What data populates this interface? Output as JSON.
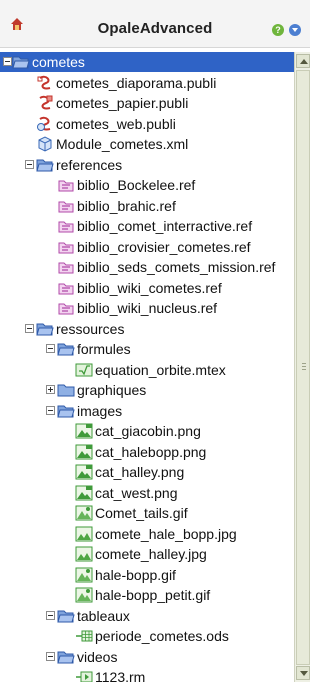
{
  "header": {
    "title": "OpaleAdvanced",
    "app_icon": "opale-app-icon",
    "help_icon": "help-icon",
    "menu_icon": "down-arrow-menu-icon"
  },
  "tree": [
    {
      "label": "cometes",
      "icon": "folder-open-icon",
      "level": 0,
      "toggle": "minus",
      "selected": true
    },
    {
      "label": "cometes_diaporama.publi",
      "icon": "publi-diaporama-icon",
      "level": 1
    },
    {
      "label": "cometes_papier.publi",
      "icon": "publi-papier-icon",
      "level": 1
    },
    {
      "label": "cometes_web.publi",
      "icon": "publi-web-icon",
      "level": 1
    },
    {
      "label": "Module_cometes.xml",
      "icon": "module-xml-icon",
      "level": 1
    },
    {
      "label": "references",
      "icon": "folder-open-icon",
      "level": 1,
      "toggle": "minus"
    },
    {
      "label": "biblio_Bockelee.ref",
      "icon": "ref-icon",
      "level": 2
    },
    {
      "label": "biblio_brahic.ref",
      "icon": "ref-icon",
      "level": 2
    },
    {
      "label": "biblio_comet_interractive.ref",
      "icon": "ref-icon",
      "level": 2
    },
    {
      "label": "biblio_crovisier_cometes.ref",
      "icon": "ref-icon",
      "level": 2
    },
    {
      "label": "biblio_seds_comets_mission.ref",
      "icon": "ref-icon",
      "level": 2
    },
    {
      "label": "biblio_wiki_cometes.ref",
      "icon": "ref-icon",
      "level": 2
    },
    {
      "label": "biblio_wiki_nucleus.ref",
      "icon": "ref-icon",
      "level": 2
    },
    {
      "label": "ressources",
      "icon": "folder-open-icon",
      "level": 1,
      "toggle": "minus"
    },
    {
      "label": "formules",
      "icon": "folder-open-icon",
      "level": 2,
      "toggle": "minus"
    },
    {
      "label": "equation_orbite.mtex",
      "icon": "formula-icon",
      "level": 3
    },
    {
      "label": "graphiques",
      "icon": "folder-closed-icon",
      "level": 2,
      "toggle": "plus"
    },
    {
      "label": "images",
      "icon": "folder-open-icon",
      "level": 2,
      "toggle": "minus"
    },
    {
      "label": "cat_giacobin.png",
      "icon": "png-image-icon",
      "level": 3
    },
    {
      "label": "cat_halebopp.png",
      "icon": "png-image-icon",
      "level": 3
    },
    {
      "label": "cat_halley.png",
      "icon": "png-image-icon",
      "level": 3
    },
    {
      "label": "cat_west.png",
      "icon": "png-image-icon",
      "level": 3
    },
    {
      "label": "Comet_tails.gif",
      "icon": "gif-image-icon",
      "level": 3
    },
    {
      "label": "comete_hale_bopp.jpg",
      "icon": "jpg-image-icon",
      "level": 3
    },
    {
      "label": "comete_halley.jpg",
      "icon": "jpg-image-icon",
      "level": 3
    },
    {
      "label": "hale-bopp.gif",
      "icon": "gif-image-icon",
      "level": 3
    },
    {
      "label": "hale-bopp_petit.gif",
      "icon": "gif-image-icon",
      "level": 3
    },
    {
      "label": "tableaux",
      "icon": "folder-open-icon",
      "level": 2,
      "toggle": "minus"
    },
    {
      "label": "periode_cometes.ods",
      "icon": "spreadsheet-icon",
      "level": 3
    },
    {
      "label": "videos",
      "icon": "folder-open-icon",
      "level": 2,
      "toggle": "minus"
    },
    {
      "label": "1123.rm",
      "icon": "video-icon",
      "level": 3
    }
  ],
  "colors": {
    "selection": "#2f63c6",
    "folder": "#4a78c9",
    "ref": "#b04aa8",
    "publi": "#c4342c",
    "image": "#3f9a3a"
  }
}
